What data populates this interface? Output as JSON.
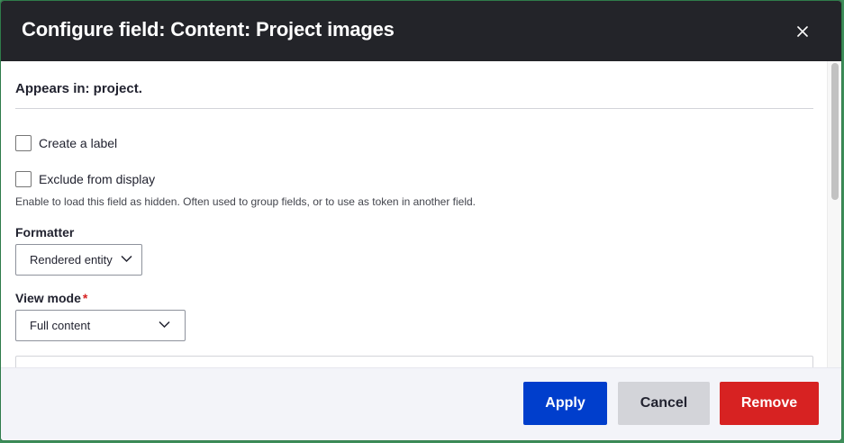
{
  "dialog": {
    "title": "Configure field: Content: Project images",
    "close_icon": "close-icon"
  },
  "form": {
    "appears_in": "Appears in: project.",
    "create_label": "Create a label",
    "exclude_from_display": "Exclude from display",
    "exclude_help": "Enable to load this field as hidden. Often used to group fields, or to use as token in another field.",
    "formatter_label": "Formatter",
    "formatter_value": "Rendered entity",
    "view_mode_label": "View mode",
    "view_mode_required": "*",
    "view_mode_value": "Full content",
    "dropdown_icon": "chevron-down-icon"
  },
  "footer": {
    "apply": "Apply",
    "cancel": "Cancel",
    "remove": "Remove"
  },
  "colors": {
    "titlebar": "#232429",
    "primary": "#003ecc",
    "danger": "#d72222",
    "secondary": "#d3d4d9"
  }
}
